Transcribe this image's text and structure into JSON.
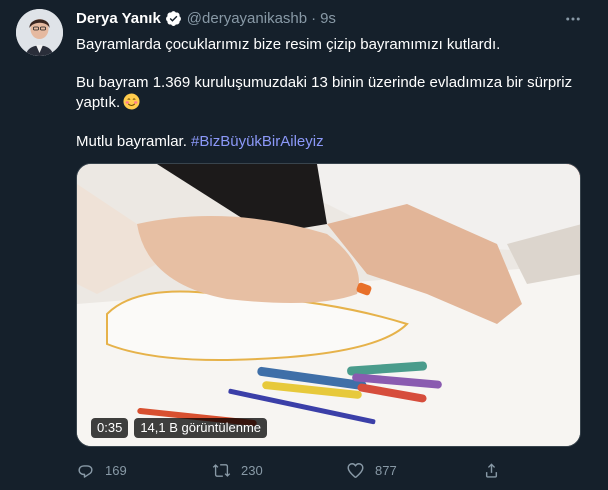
{
  "tweet": {
    "author_name": "Derya Yanık",
    "handle": "@deryayanikashb",
    "separator": "·",
    "time": "9s",
    "line1": "Bayramlarda çocuklarımız bize resim çizip bayramımızı kutlardı.",
    "line2": "Bu bayram 1.369 kuruluşumuzdaki 13 binin üzerinde evladımıza bir sürpriz",
    "line3": "yaptık.",
    "line4_prefix": "Mutlu bayramlar. ",
    "hashtag": "#BizBüyükBirAileyiz",
    "emoji": "smiling-face-with-blush"
  },
  "video": {
    "duration": "0:35",
    "views": "14,1 B görüntülenme"
  },
  "actions": {
    "replies": "169",
    "retweets": "230",
    "likes": "877"
  },
  "colors": {
    "background": "#15202b",
    "muted": "#8899a6",
    "hashtag": "#8b98f8",
    "verified": "#1d9bf0"
  }
}
